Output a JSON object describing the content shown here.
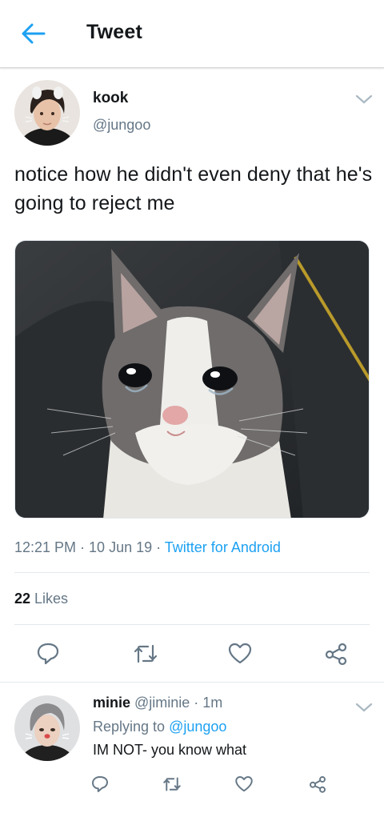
{
  "colors": {
    "accent": "#1da1f2",
    "secondary_text": "#657786",
    "divider": "#e1e8ed"
  },
  "header": {
    "back_icon": "arrow-left-icon",
    "title": "Tweet"
  },
  "tweet": {
    "name": "kook",
    "handle": "@jungoo",
    "text": "notice how he didn't even deny that he's going to reject me",
    "time": "12:21 PM",
    "sep1": " · ",
    "date": "10 Jun 19",
    "sep2": " · ",
    "source": "Twitter for Android",
    "likes_count": "22",
    "likes_label": " Likes",
    "actions": [
      "reply-icon",
      "retweet-icon",
      "like-icon",
      "share-icon"
    ]
  },
  "reply": {
    "name": "minie",
    "handle_time": " @jiminie · 1m",
    "replying_to_label": "Replying to ",
    "replying_to_handle": "@jungoo",
    "text": "IM NOT- you know what"
  }
}
